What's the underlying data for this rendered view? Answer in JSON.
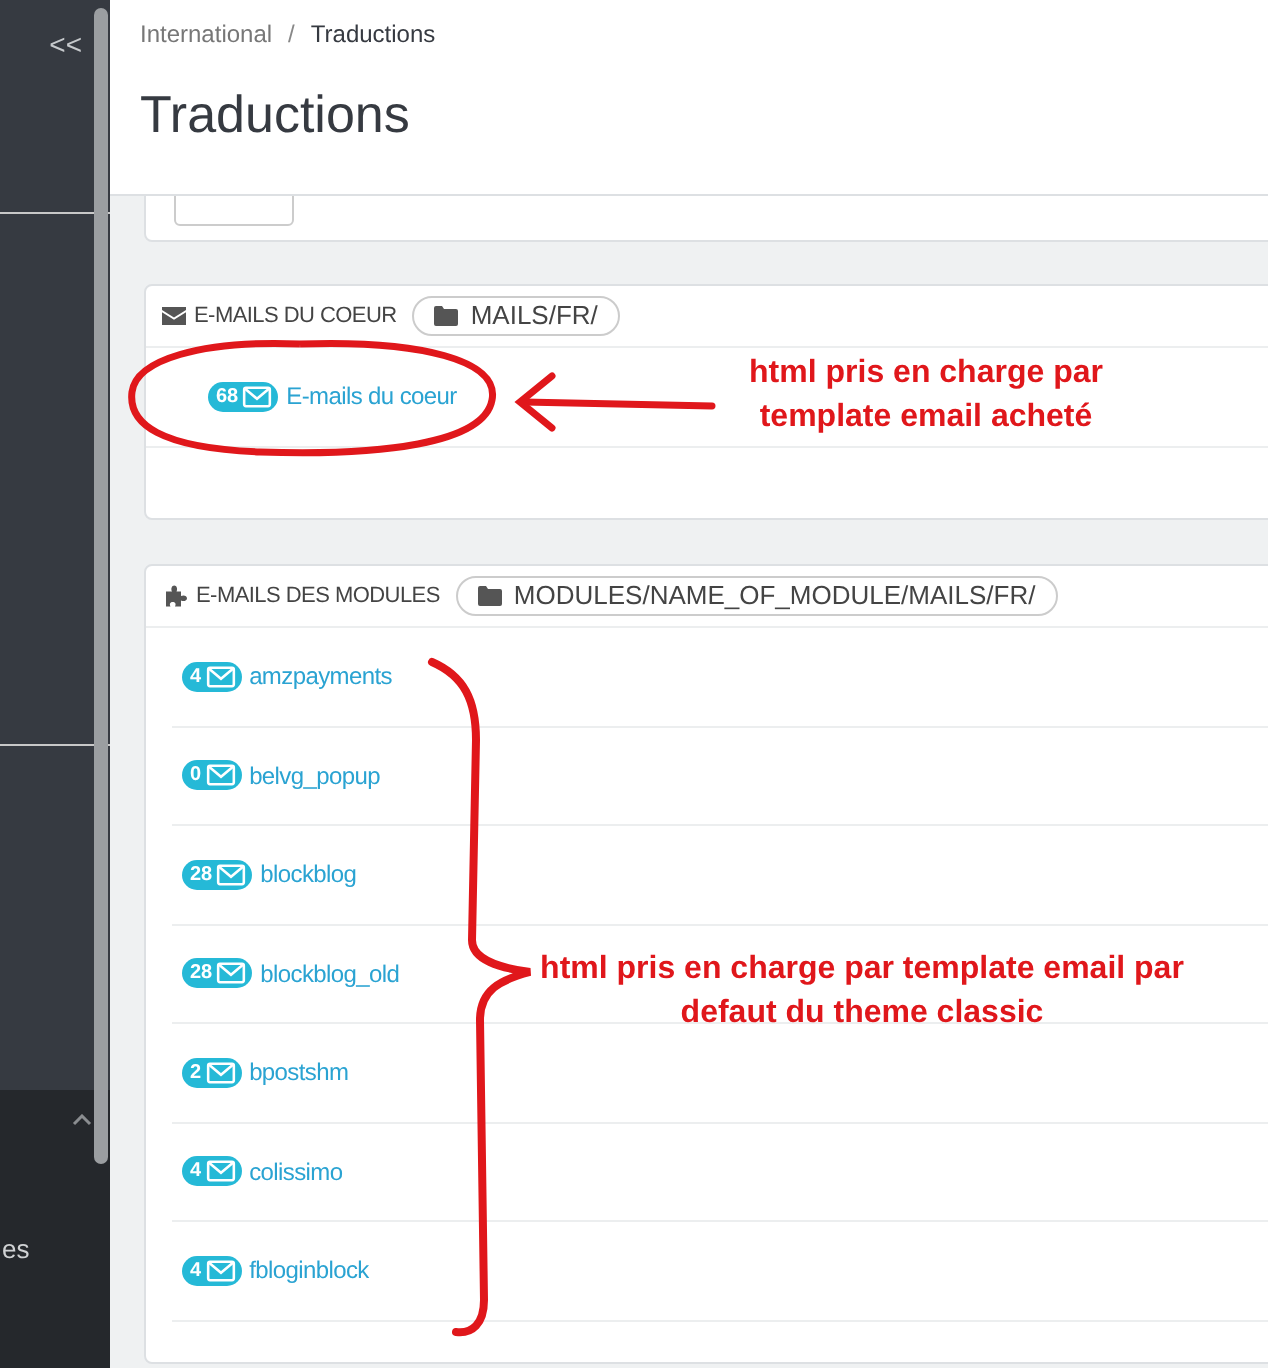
{
  "sidebar": {
    "collapse_label": "<<",
    "partial_item": "es"
  },
  "breadcrumb": {
    "items": [
      "International",
      "Traductions"
    ],
    "separator": "/"
  },
  "title": "Traductions",
  "sections": [
    {
      "kind": "mail",
      "title": "E-MAILS DU COEUR",
      "path": "MAILS/FR/",
      "items": [
        {
          "count": "68",
          "name": "E-mails du coeur"
        }
      ]
    },
    {
      "kind": "module",
      "title": "E-MAILS DES MODULES",
      "path": "MODULES/NAME_OF_MODULE/MAILS/FR/",
      "items": [
        {
          "count": "4",
          "name": "amzpayments"
        },
        {
          "count": "0",
          "name": "belvg_popup"
        },
        {
          "count": "28",
          "name": "blockblog"
        },
        {
          "count": "28",
          "name": "blockblog_old"
        },
        {
          "count": "2",
          "name": "bpostshm"
        },
        {
          "count": "4",
          "name": "colissimo"
        },
        {
          "count": "4",
          "name": "fbloginblock"
        }
      ]
    }
  ],
  "annotations": [
    {
      "kind": "circle-arrow",
      "text": "html pris en charge par template email acheté"
    },
    {
      "kind": "brace",
      "text": "html pris en charge par template email par defaut du theme classic"
    }
  ]
}
